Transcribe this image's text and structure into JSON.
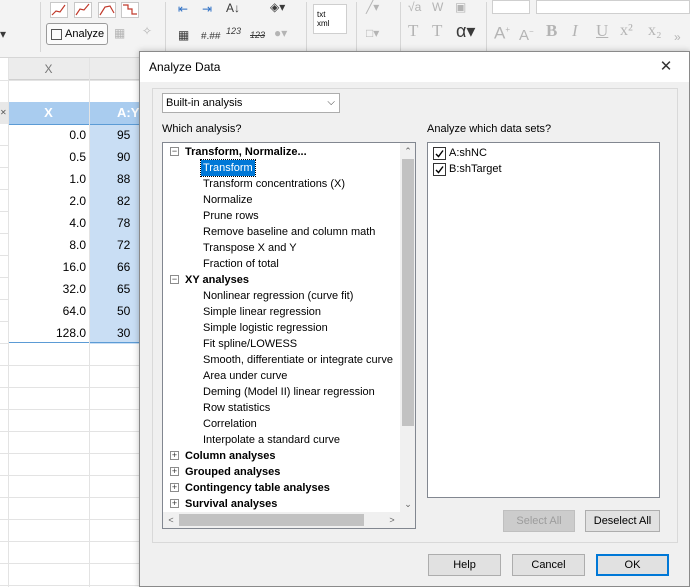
{
  "app": {
    "toolbar": {
      "analyze_label": "Analyze",
      "text_tools": [
        "A",
        "A",
        "B",
        "I",
        "U",
        "x²",
        "x₂"
      ],
      "insert_txt_label": "txt\nxml",
      "num_format_a": "123",
      "num_format_b": "123",
      "hash_label": "#.##",
      "alpha_label": "α"
    },
    "sheet": {
      "col_x_header": "X",
      "col_x_title": "X",
      "col_y_title": "A:Y",
      "x_values": [
        "0.0",
        "0.5",
        "1.0",
        "2.0",
        "4.0",
        "8.0",
        "16.0",
        "32.0",
        "64.0",
        "128.0"
      ],
      "y_values_partial": [
        "95",
        "90",
        "88",
        "82",
        "78",
        "72",
        "66",
        "65",
        "50",
        "30"
      ]
    }
  },
  "dialog": {
    "title": "Analyze Data",
    "close_glyph": "✕",
    "analysis_source": {
      "selected": "Built-in analysis",
      "arrow": "⌵"
    },
    "which_analysis_label": "Which analysis?",
    "datasets_label": "Analyze which data sets?",
    "tree": [
      {
        "kind": "category",
        "label": "Transform, Normalize...",
        "expanded": true,
        "expander": "−"
      },
      {
        "kind": "item",
        "label": "Transform",
        "selected": true
      },
      {
        "kind": "item",
        "label": "Transform concentrations (X)"
      },
      {
        "kind": "item",
        "label": "Normalize"
      },
      {
        "kind": "item",
        "label": "Prune rows"
      },
      {
        "kind": "item",
        "label": "Remove baseline and column math"
      },
      {
        "kind": "item",
        "label": "Transpose X and Y"
      },
      {
        "kind": "item",
        "label": "Fraction of total"
      },
      {
        "kind": "category",
        "label": "XY analyses",
        "expanded": true,
        "expander": "−"
      },
      {
        "kind": "item",
        "label": "Nonlinear regression (curve fit)"
      },
      {
        "kind": "item",
        "label": "Simple linear regression"
      },
      {
        "kind": "item",
        "label": "Simple logistic regression"
      },
      {
        "kind": "item",
        "label": "Fit spline/LOWESS"
      },
      {
        "kind": "item",
        "label": "Smooth, differentiate or integrate curve"
      },
      {
        "kind": "item",
        "label": "Area under curve"
      },
      {
        "kind": "item",
        "label": "Deming (Model II) linear regression"
      },
      {
        "kind": "item",
        "label": "Row statistics"
      },
      {
        "kind": "item",
        "label": "Correlation"
      },
      {
        "kind": "item",
        "label": "Interpolate a standard curve"
      },
      {
        "kind": "category",
        "label": "Column analyses",
        "expanded": false,
        "expander": "+"
      },
      {
        "kind": "category",
        "label": "Grouped analyses",
        "expanded": false,
        "expander": "+"
      },
      {
        "kind": "category",
        "label": "Contingency table analyses",
        "expanded": false,
        "expander": "+"
      },
      {
        "kind": "category",
        "label": "Survival analyses",
        "expanded": false,
        "expander": "+"
      }
    ],
    "datasets": [
      {
        "label": "A:shNC",
        "checked": true
      },
      {
        "label": "B:shTarget",
        "checked": true
      }
    ],
    "buttons": {
      "select_all": "Select All",
      "deselect_all": "Deselect All",
      "help": "Help",
      "cancel": "Cancel",
      "ok": "OK"
    },
    "scroll_arrows": {
      "up": "⌃",
      "down": "⌄",
      "left": "<",
      "right": ">"
    },
    "accent_color": "#0078d7"
  }
}
